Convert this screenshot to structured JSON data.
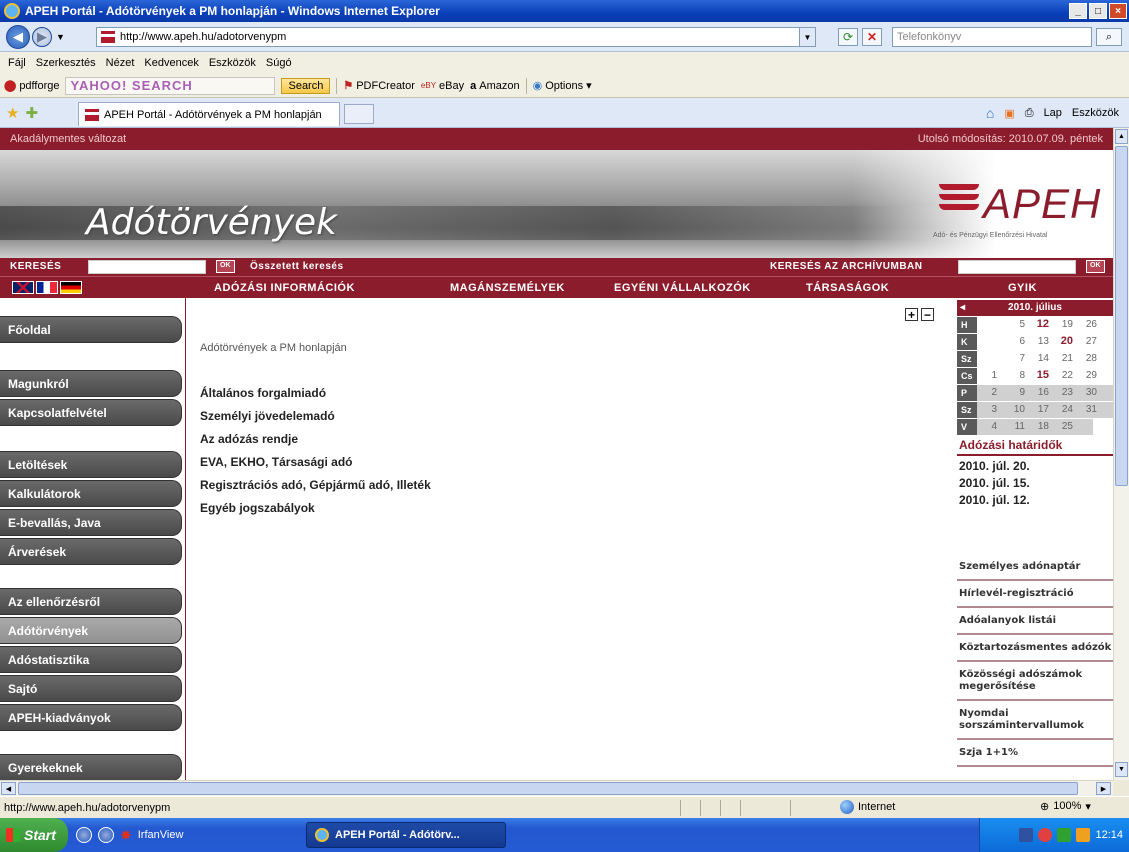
{
  "window": {
    "title": "APEH Portál - Adótörvények a PM honlapján - Windows Internet Explorer",
    "minimize": "_",
    "maximize": "□",
    "close": "×"
  },
  "address": {
    "url": "http://www.apeh.hu/adotorvenypm",
    "search_placeholder": "Telefonkönyv"
  },
  "menu": [
    "Fájl",
    "Szerkesztés",
    "Nézet",
    "Kedvencek",
    "Eszközök",
    "Súgó"
  ],
  "toolbar": {
    "pdfforge": "pdfforge",
    "yahoo": "YAHOO! SEARCH",
    "search_button": "Search",
    "pdfcreator": "PDFCreator",
    "ebay": "eBay",
    "amazon": "Amazon",
    "options": "Options"
  },
  "tabbar": {
    "tab_title": "APEH Portál - Adótörvények a PM honlapján",
    "home": "⌂",
    "feeds": "▣",
    "print": "⎙",
    "page": "Lap",
    "tools": "Eszközök"
  },
  "site": {
    "accessible": "Akadálymentes változat",
    "last_modified": "Utolsó módosítás: 2010.07.09. péntek",
    "banner_title": "Adótörvények",
    "logo_name": "APEH",
    "logo_sub": "Adó- és Pénzügyi Ellenőrzési Hivatal",
    "search_label": "KERESÉS",
    "ok": "OK",
    "advanced_search": "Összetett keresés",
    "archive_search": "KERESÉS AZ ARCHÍVUMBAN",
    "nav": [
      "ADÓZÁSI INFORMÁCIÓK",
      "MAGÁNSZEMÉLYEK",
      "EGYÉNI VÁLLALKOZÓK",
      "TÁRSASÁGOK",
      "GYIK"
    ]
  },
  "left_menu": [
    "Főoldal",
    "Magunkról",
    "Kapcsolatfelvétel",
    "Letöltések",
    "Kalkulátorok",
    "E-bevallás, Java",
    "Árverések",
    "Az ellenőrzésről",
    "Adótörvények",
    "Adóstatisztika",
    "Sajtó",
    "APEH-kiadványok",
    "Gyerekeknek"
  ],
  "content": {
    "breadcrumb": "Adótörvények a PM honlapján",
    "plus": "+",
    "minus": "−",
    "links": [
      "Általános forgalmiadó",
      "Személyi jövedelemadó",
      "Az adózás rendje",
      "EVA, EKHO, Társasági adó",
      "Regisztrációs adó, Gépjármű adó, Illeték",
      "Egyéb jogszabályok"
    ]
  },
  "calendar": {
    "prev": "◂",
    "month": "2010. július",
    "rows": [
      {
        "day": "H",
        "cells": [
          "",
          "5",
          "12",
          "19",
          "26"
        ]
      },
      {
        "day": "K",
        "cells": [
          "",
          "6",
          "13",
          "20",
          "27"
        ]
      },
      {
        "day": "Sz",
        "cells": [
          "",
          "7",
          "14",
          "21",
          "28"
        ]
      },
      {
        "day": "Cs",
        "cells": [
          "1",
          "8",
          "15",
          "22",
          "29"
        ]
      },
      {
        "day": "P",
        "cells": [
          "2",
          "9",
          "16",
          "23",
          "30"
        ]
      },
      {
        "day": "Sz",
        "cells": [
          "3",
          "10",
          "17",
          "24",
          "31"
        ]
      },
      {
        "day": "V",
        "cells": [
          "4",
          "11",
          "18",
          "25",
          ""
        ]
      }
    ]
  },
  "deadlines": {
    "title": "Adózási határidők",
    "items": [
      "2010. júl. 20.",
      "2010. júl. 15.",
      "2010. júl. 12."
    ]
  },
  "side_links": [
    "Személyes adónaptár",
    "Hírlevél-regisztráció",
    "Adóalanyok listái",
    "Köztartozásmentes adózók",
    "Közösségi adószámok megerősítése",
    "Nyomdai sorszámintervallumok",
    "Szja 1+1%"
  ],
  "status": {
    "url": "http://www.apeh.hu/adotorvenypm",
    "zone": "Internet",
    "zoom": "100%"
  },
  "taskbar": {
    "start": "Start",
    "irfanview": "IrfanView",
    "task": "APEH Portál - Adótörv...",
    "clock": "12:14"
  }
}
